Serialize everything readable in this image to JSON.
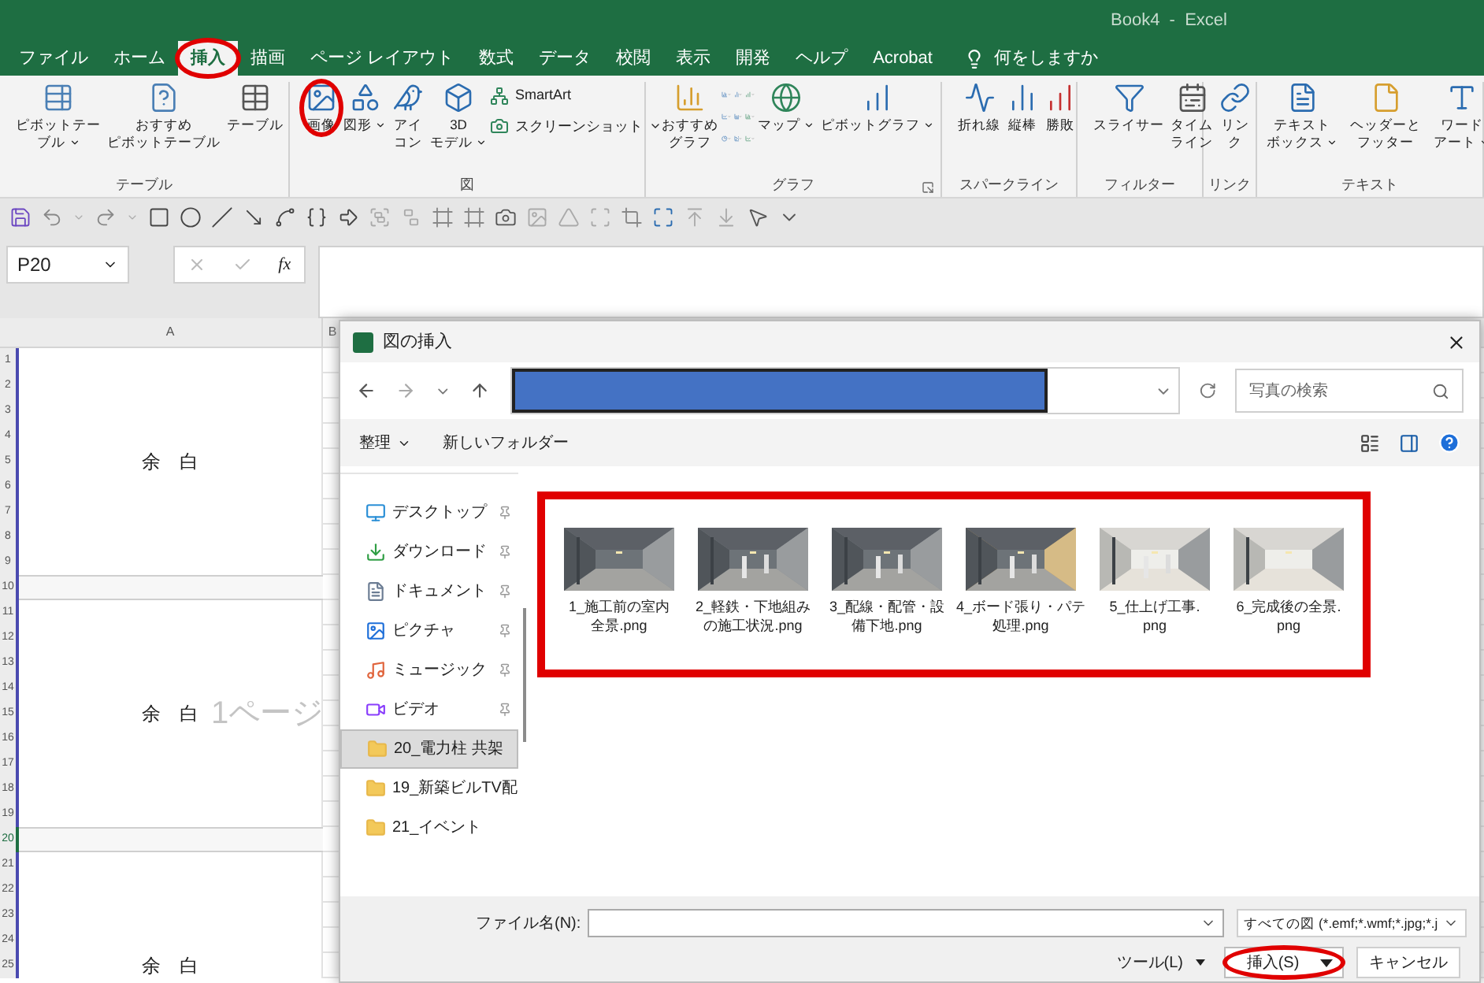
{
  "window": {
    "title": "Book4  -  Excel"
  },
  "tabs": [
    {
      "label": "ファイル",
      "selected": false
    },
    {
      "label": "ホーム",
      "selected": false
    },
    {
      "label": "挿入",
      "selected": true,
      "circled": true
    },
    {
      "label": "描画",
      "selected": false
    },
    {
      "label": "ページ レイアウト",
      "selected": false
    },
    {
      "label": "数式",
      "selected": false
    },
    {
      "label": "データ",
      "selected": false
    },
    {
      "label": "校閲",
      "selected": false
    },
    {
      "label": "表示",
      "selected": false
    },
    {
      "label": "開発",
      "selected": false
    },
    {
      "label": "ヘルプ",
      "selected": false
    },
    {
      "label": "Acrobat",
      "selected": false
    }
  ],
  "tell_me": {
    "placeholder": "何をしますか"
  },
  "ribbon_groups": [
    {
      "label": "テーブル",
      "buttons": [
        {
          "lines": [
            "ピボットテー",
            "ブル"
          ],
          "dropdown": true
        },
        {
          "lines": [
            "おすすめ",
            "ピボットテーブル"
          ]
        },
        {
          "lines": [
            "テーブル"
          ]
        }
      ]
    },
    {
      "label": "図",
      "buttons": [
        {
          "lines": [
            "画像"
          ],
          "circled": true
        },
        {
          "lines": [
            "図形"
          ],
          "dropdown": true
        },
        {
          "lines": [
            "アイ",
            "コン"
          ]
        },
        {
          "lines": [
            "3D",
            "モデル"
          ],
          "dropdown": true
        }
      ],
      "small_buttons": [
        {
          "label": "SmartArt"
        },
        {
          "label": "スクリーンショット",
          "dropdown": true
        }
      ]
    },
    {
      "label": "グラフ",
      "launcher": true,
      "chart_grid": true,
      "buttons": [
        {
          "lines": [
            "おすすめ",
            "グラフ"
          ]
        },
        {
          "lines": [
            "マップ"
          ],
          "dropdown": true
        },
        {
          "lines": [
            "ピボットグラフ"
          ],
          "dropdown": true
        }
      ]
    },
    {
      "label": "スパークライン",
      "buttons": [
        {
          "lines": [
            "折れ線"
          ]
        },
        {
          "lines": [
            "縦棒"
          ]
        },
        {
          "lines": [
            "勝敗"
          ]
        }
      ]
    },
    {
      "label": "フィルター",
      "buttons": [
        {
          "lines": [
            "スライサー"
          ]
        },
        {
          "lines": [
            "タイム",
            "ライン"
          ]
        }
      ]
    },
    {
      "label": "リンク",
      "buttons": [
        {
          "lines": [
            "リン",
            "ク"
          ]
        }
      ]
    },
    {
      "label": "テキスト",
      "buttons": [
        {
          "lines": [
            "テキスト",
            "ボックス"
          ],
          "dropdown": true
        },
        {
          "lines": [
            "ヘッダーと",
            "フッター"
          ]
        },
        {
          "lines": [
            "ワード",
            "アート"
          ],
          "dropdown": true
        }
      ]
    }
  ],
  "name_box": {
    "value": "P20"
  },
  "function_symbol": "fx",
  "sheet": {
    "columns": [
      "A",
      "B"
    ],
    "rows": [
      {
        "number": "1",
        "selected": false
      },
      {
        "number": "2",
        "selected": false
      },
      {
        "number": "3",
        "selected": false
      },
      {
        "number": "4",
        "selected": false
      },
      {
        "number": "5",
        "selected": false,
        "cell": "余　白"
      },
      {
        "number": "6",
        "selected": false
      },
      {
        "number": "7",
        "selected": false
      },
      {
        "number": "8",
        "selected": false
      },
      {
        "number": "9",
        "selected": false
      },
      {
        "number": "10",
        "page_gap": true,
        "selected": false
      },
      {
        "number": "11",
        "selected": false
      },
      {
        "number": "12",
        "selected": false
      },
      {
        "number": "13",
        "selected": false
      },
      {
        "number": "14",
        "selected": false
      },
      {
        "number": "15",
        "selected": false,
        "cell": "余　白",
        "page_label": "1ページ"
      },
      {
        "number": "16",
        "selected": false
      },
      {
        "number": "17",
        "selected": false
      },
      {
        "number": "18",
        "selected": false
      },
      {
        "number": "19",
        "selected": false
      },
      {
        "number": "20",
        "page_gap": true,
        "selected": true
      },
      {
        "number": "21",
        "selected": false
      },
      {
        "number": "22",
        "selected": false
      },
      {
        "number": "23",
        "selected": false
      },
      {
        "number": "24",
        "selected": false
      },
      {
        "number": "25",
        "selected": false,
        "cell": "余　白"
      }
    ]
  },
  "dialog": {
    "title": "図の挿入",
    "search": {
      "placeholder": "写真の検索"
    },
    "organize": "整理",
    "new_folder": "新しいフォルダー",
    "nav_items": [
      {
        "label": "デスクトップ",
        "kind": "desktop",
        "pinned": true,
        "selected": false
      },
      {
        "label": "ダウンロード",
        "kind": "download",
        "pinned": true,
        "selected": false
      },
      {
        "label": "ドキュメント",
        "kind": "documents",
        "pinned": true,
        "selected": false
      },
      {
        "label": "ピクチャ",
        "kind": "pictures",
        "pinned": true,
        "selected": false
      },
      {
        "label": "ミュージック",
        "kind": "music",
        "pinned": true,
        "selected": false
      },
      {
        "label": "ビデオ",
        "kind": "video",
        "pinned": true,
        "selected": false
      },
      {
        "label": "20_電力柱 共架",
        "kind": "folder",
        "pinned": false,
        "selected": true
      },
      {
        "label": "19_新築ビルTV配",
        "kind": "folder",
        "pinned": false,
        "selected": false
      },
      {
        "label": "21_イベント",
        "kind": "folder",
        "pinned": false,
        "selected": false
      }
    ],
    "files_highlighted": true,
    "files": [
      {
        "lines": [
          "1_施工前の室内",
          "全景.png"
        ],
        "kind": "picture"
      },
      {
        "lines": [
          "2_軽鉄・下地組み",
          "の施工状況.png"
        ],
        "kind": "picture"
      },
      {
        "lines": [
          "3_配線・配管・設",
          "備下地.png"
        ],
        "kind": "picture"
      },
      {
        "lines": [
          "4_ボード張り・パテ",
          "処理.png"
        ],
        "kind": "picture"
      },
      {
        "lines": [
          "5_仕上げ工事.",
          "png"
        ],
        "kind": "picture"
      },
      {
        "lines": [
          "6_完成後の全景.",
          "png"
        ],
        "kind": "picture"
      }
    ],
    "filename_label": "ファイル名(N):",
    "file_type": "すべての図 (*.emf;*.wmf;*.jpg;*.j",
    "tools": "ツール(L)",
    "insert_button": {
      "label": "挿入(S)",
      "circled": true
    },
    "cancel_button": "キャンセル"
  }
}
